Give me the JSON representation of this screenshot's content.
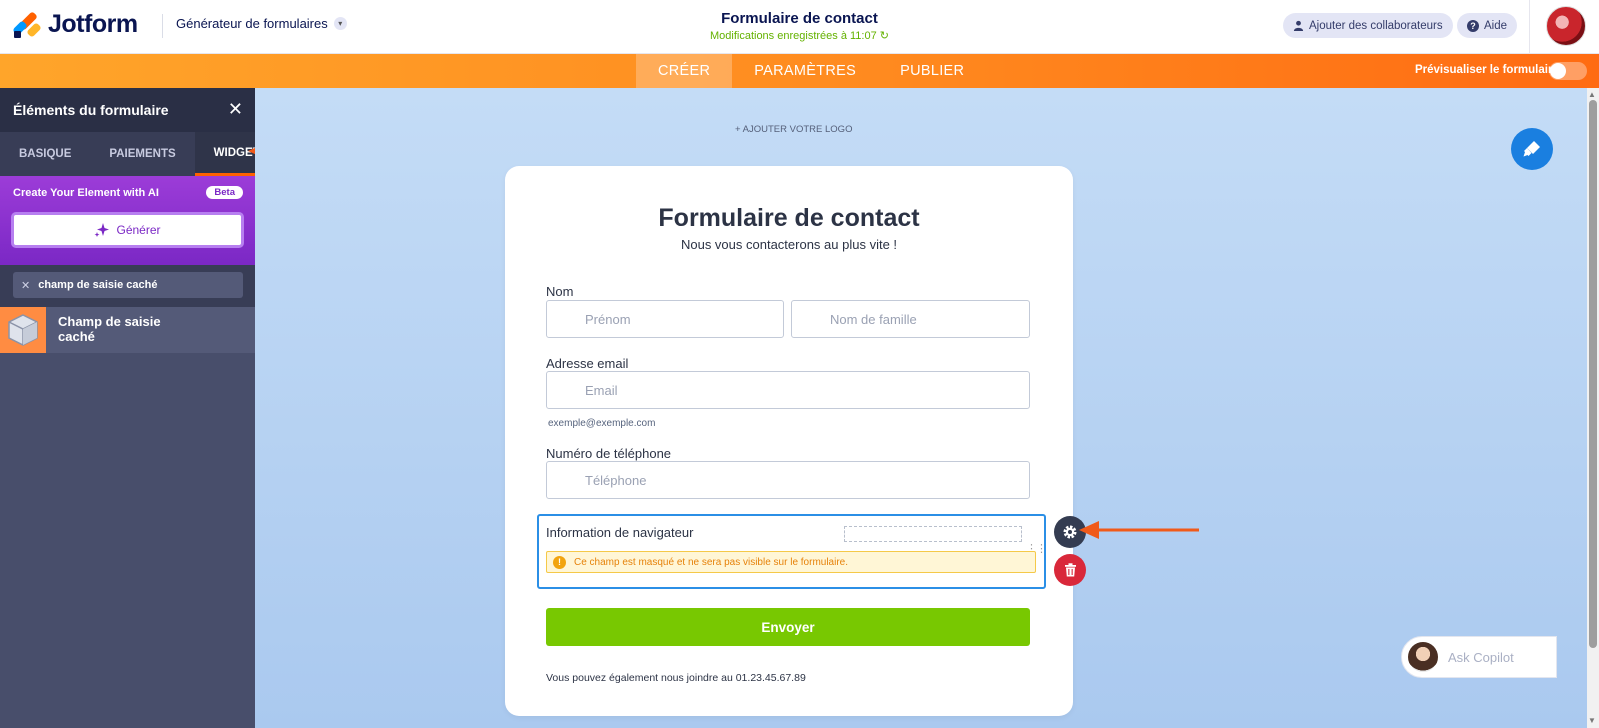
{
  "header": {
    "brand": "Jotform",
    "builder_label": "Générateur de formulaires",
    "form_title": "Formulaire de contact",
    "saved_status": "Modifications enregistrées à 11:07",
    "collaborators_label": "Ajouter des collaborateurs",
    "help_label": "Aide"
  },
  "nav": {
    "tabs": [
      {
        "label": "CRÉER",
        "active": true
      },
      {
        "label": "PARAMÈTRES",
        "active": false
      },
      {
        "label": "PUBLIER",
        "active": false
      }
    ],
    "preview_label": "Prévisualiser le formulaire"
  },
  "sidebar": {
    "title": "Éléments du formulaire",
    "tabs": [
      {
        "label": "BASIQUE",
        "active": false
      },
      {
        "label": "PAIEMENTS",
        "active": false
      },
      {
        "label": "WIDGETS",
        "active": true
      }
    ],
    "ai": {
      "title": "Create Your Element with AI",
      "badge": "Beta",
      "generate_label": "Générer"
    },
    "search_value": "champ de saisie caché",
    "results": [
      {
        "label": "Champ de saisie caché"
      }
    ]
  },
  "canvas": {
    "add_logo": "+ AJOUTER VOTRE LOGO",
    "form": {
      "title": "Formulaire de contact",
      "subtitle": "Nous vous contacterons au plus vite !",
      "name_label": "Nom",
      "first_name_placeholder": "Prénom",
      "last_name_placeholder": "Nom de famille",
      "email_label": "Adresse email",
      "email_placeholder": "Email",
      "email_sublabel": "exemple@exemple.com",
      "phone_label": "Numéro de téléphone",
      "phone_placeholder": "Téléphone",
      "hidden_field_label": "Information de navigateur",
      "hidden_warning": "Ce champ est masqué et ne sera pas visible sur le formulaire.",
      "submit_label": "Envoyer",
      "contact_line": "Vous pouvez également nous joindre au 01.23.45.67.89"
    },
    "copilot_label": "Ask Copilot"
  },
  "colors": {
    "accent_orange": "#ff6100",
    "ai_purple": "#7b28c5",
    "submit_green": "#78c801",
    "selection_blue": "#2b8fe6",
    "delete_red": "#d9283a"
  }
}
